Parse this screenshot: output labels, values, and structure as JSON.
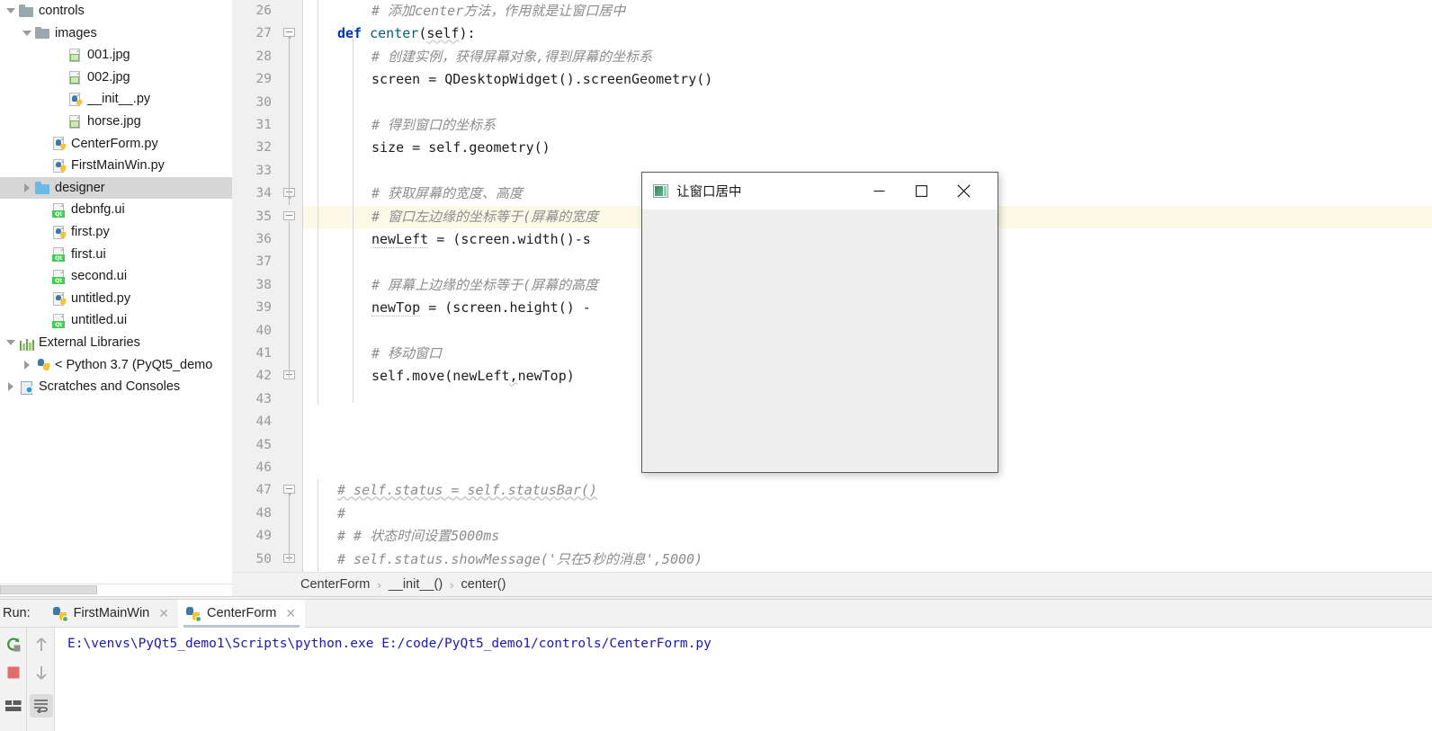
{
  "project_tree": [
    {
      "label": "controls",
      "indent": 0,
      "twisty": "down",
      "icon": "folder-gray",
      "selected": false
    },
    {
      "label": "images",
      "indent": 1,
      "twisty": "down",
      "icon": "folder-gray",
      "selected": false
    },
    {
      "label": "001.jpg",
      "indent": 3,
      "twisty": "none",
      "icon": "image-file",
      "selected": false
    },
    {
      "label": "002.jpg",
      "indent": 3,
      "twisty": "none",
      "icon": "image-file",
      "selected": false
    },
    {
      "label": "__init__.py",
      "indent": 3,
      "twisty": "none",
      "icon": "python-file",
      "selected": false
    },
    {
      "label": "horse.jpg",
      "indent": 3,
      "twisty": "none",
      "icon": "image-file",
      "selected": false
    },
    {
      "label": "CenterForm.py",
      "indent": 2,
      "twisty": "none",
      "icon": "python-file",
      "selected": false
    },
    {
      "label": "FirstMainWin.py",
      "indent": 2,
      "twisty": "none",
      "icon": "python-file",
      "selected": false
    },
    {
      "label": "designer",
      "indent": 1,
      "twisty": "right",
      "icon": "folder-blue",
      "selected": true
    },
    {
      "label": "debnfg.ui",
      "indent": 2,
      "twisty": "none",
      "icon": "qt-file",
      "selected": false
    },
    {
      "label": "first.py",
      "indent": 2,
      "twisty": "none",
      "icon": "python-file",
      "selected": false
    },
    {
      "label": "first.ui",
      "indent": 2,
      "twisty": "none",
      "icon": "qt-file",
      "selected": false
    },
    {
      "label": "second.ui",
      "indent": 2,
      "twisty": "none",
      "icon": "qt-file",
      "selected": false
    },
    {
      "label": "untitled.py",
      "indent": 2,
      "twisty": "none",
      "icon": "python-file",
      "selected": false
    },
    {
      "label": "untitled.ui",
      "indent": 2,
      "twisty": "none",
      "icon": "qt-file",
      "selected": false
    },
    {
      "label": "External Libraries",
      "indent": 0,
      "twisty": "down",
      "icon": "library",
      "selected": false
    },
    {
      "label": "< Python 3.7 (PyQt5_demo",
      "indent": 1,
      "twisty": "right",
      "icon": "python-logo",
      "selected": false
    },
    {
      "label": "Scratches and Consoles",
      "indent": 0,
      "twisty": "right",
      "icon": "scratch",
      "selected": false
    }
  ],
  "editor": {
    "first_line_number": 26,
    "highlighted_line": 35,
    "lines": [
      {
        "n": 26,
        "indent": 2,
        "text": "# 添加center方法，作用就是让窗口居中",
        "style": "comment"
      },
      {
        "n": 27,
        "indent": 1,
        "text": "def center(self):",
        "style": "def"
      },
      {
        "n": 28,
        "indent": 2,
        "text": "# 创建实例，获得屏幕对象,得到屏幕的坐标系",
        "style": "comment"
      },
      {
        "n": 29,
        "indent": 2,
        "text": "screen = QDesktopWidget().screenGeometry()",
        "style": "code"
      },
      {
        "n": 30,
        "indent": 2,
        "text": "",
        "style": "code"
      },
      {
        "n": 31,
        "indent": 2,
        "text": "# 得到窗口的坐标系",
        "style": "comment"
      },
      {
        "n": 32,
        "indent": 2,
        "text": "size = self.geometry()",
        "style": "code"
      },
      {
        "n": 33,
        "indent": 2,
        "text": "",
        "style": "code"
      },
      {
        "n": 34,
        "indent": 2,
        "text": "# 获取屏幕的宽度、高度",
        "style": "comment"
      },
      {
        "n": 35,
        "indent": 2,
        "text": "# 窗口左边缘的坐标等于(屏幕的宽度",
        "style": "comment"
      },
      {
        "n": 36,
        "indent": 2,
        "text": "newLeft = (screen.width()-s",
        "style": "code"
      },
      {
        "n": 37,
        "indent": 2,
        "text": "",
        "style": "code"
      },
      {
        "n": 38,
        "indent": 2,
        "text": "# 屏幕上边缘的坐标等于(屏幕的高度",
        "style": "comment"
      },
      {
        "n": 39,
        "indent": 2,
        "text": "newTop = (screen.height() -",
        "style": "code"
      },
      {
        "n": 40,
        "indent": 2,
        "text": "",
        "style": "code"
      },
      {
        "n": 41,
        "indent": 2,
        "text": "# 移动窗口",
        "style": "comment"
      },
      {
        "n": 42,
        "indent": 2,
        "text": "self.move(newLeft,newTop)",
        "style": "code"
      },
      {
        "n": 43,
        "indent": 0,
        "text": "",
        "style": "code"
      },
      {
        "n": 44,
        "indent": 0,
        "text": "",
        "style": "code"
      },
      {
        "n": 45,
        "indent": 0,
        "text": "",
        "style": "code"
      },
      {
        "n": 46,
        "indent": 0,
        "text": "",
        "style": "code"
      },
      {
        "n": 47,
        "indent": 1,
        "text": "# self.status = self.statusBar()",
        "style": "comment"
      },
      {
        "n": 48,
        "indent": 1,
        "text": "#",
        "style": "comment"
      },
      {
        "n": 49,
        "indent": 1,
        "text": "# # 状态时间设置5000ms",
        "style": "comment"
      },
      {
        "n": 50,
        "indent": 1,
        "text": "# self.status.showMessage('只在5秒的消息',5000)",
        "style": "comment"
      }
    ]
  },
  "breadcrumb": {
    "items": [
      "CenterForm",
      "__init__()",
      "center()"
    ],
    "separator": "›"
  },
  "run_panel": {
    "label": "Run:",
    "tabs": [
      {
        "label": "FirstMainWin",
        "active": false,
        "close": "✕"
      },
      {
        "label": "CenterForm",
        "active": true,
        "close": "✕"
      }
    ],
    "console_output": "E:\\venvs\\PyQt5_demo1\\Scripts\\python.exe E:/code/PyQt5_demo1/controls/CenterForm.py",
    "toolbar": {
      "rerun": "rerun-icon",
      "stop": "stop-icon",
      "up": "↑",
      "down": "↓",
      "print": "print-icon",
      "soft_wrap": "soft-wrap-icon"
    }
  },
  "pyqt_window": {
    "title": "让窗口居中",
    "icon": "app-icon",
    "minimize": "─",
    "maximize": "☐",
    "close": "✕"
  },
  "colors": {
    "keyword": "#0033b3",
    "comment": "#8c8c8c",
    "console_text": "#1a1aad",
    "selection": "#d6d6d6",
    "line_highlight": "#fcf9e7",
    "qt_green": "#41cd52",
    "run_green": "#59a869",
    "stop_red": "#e06c6c"
  }
}
